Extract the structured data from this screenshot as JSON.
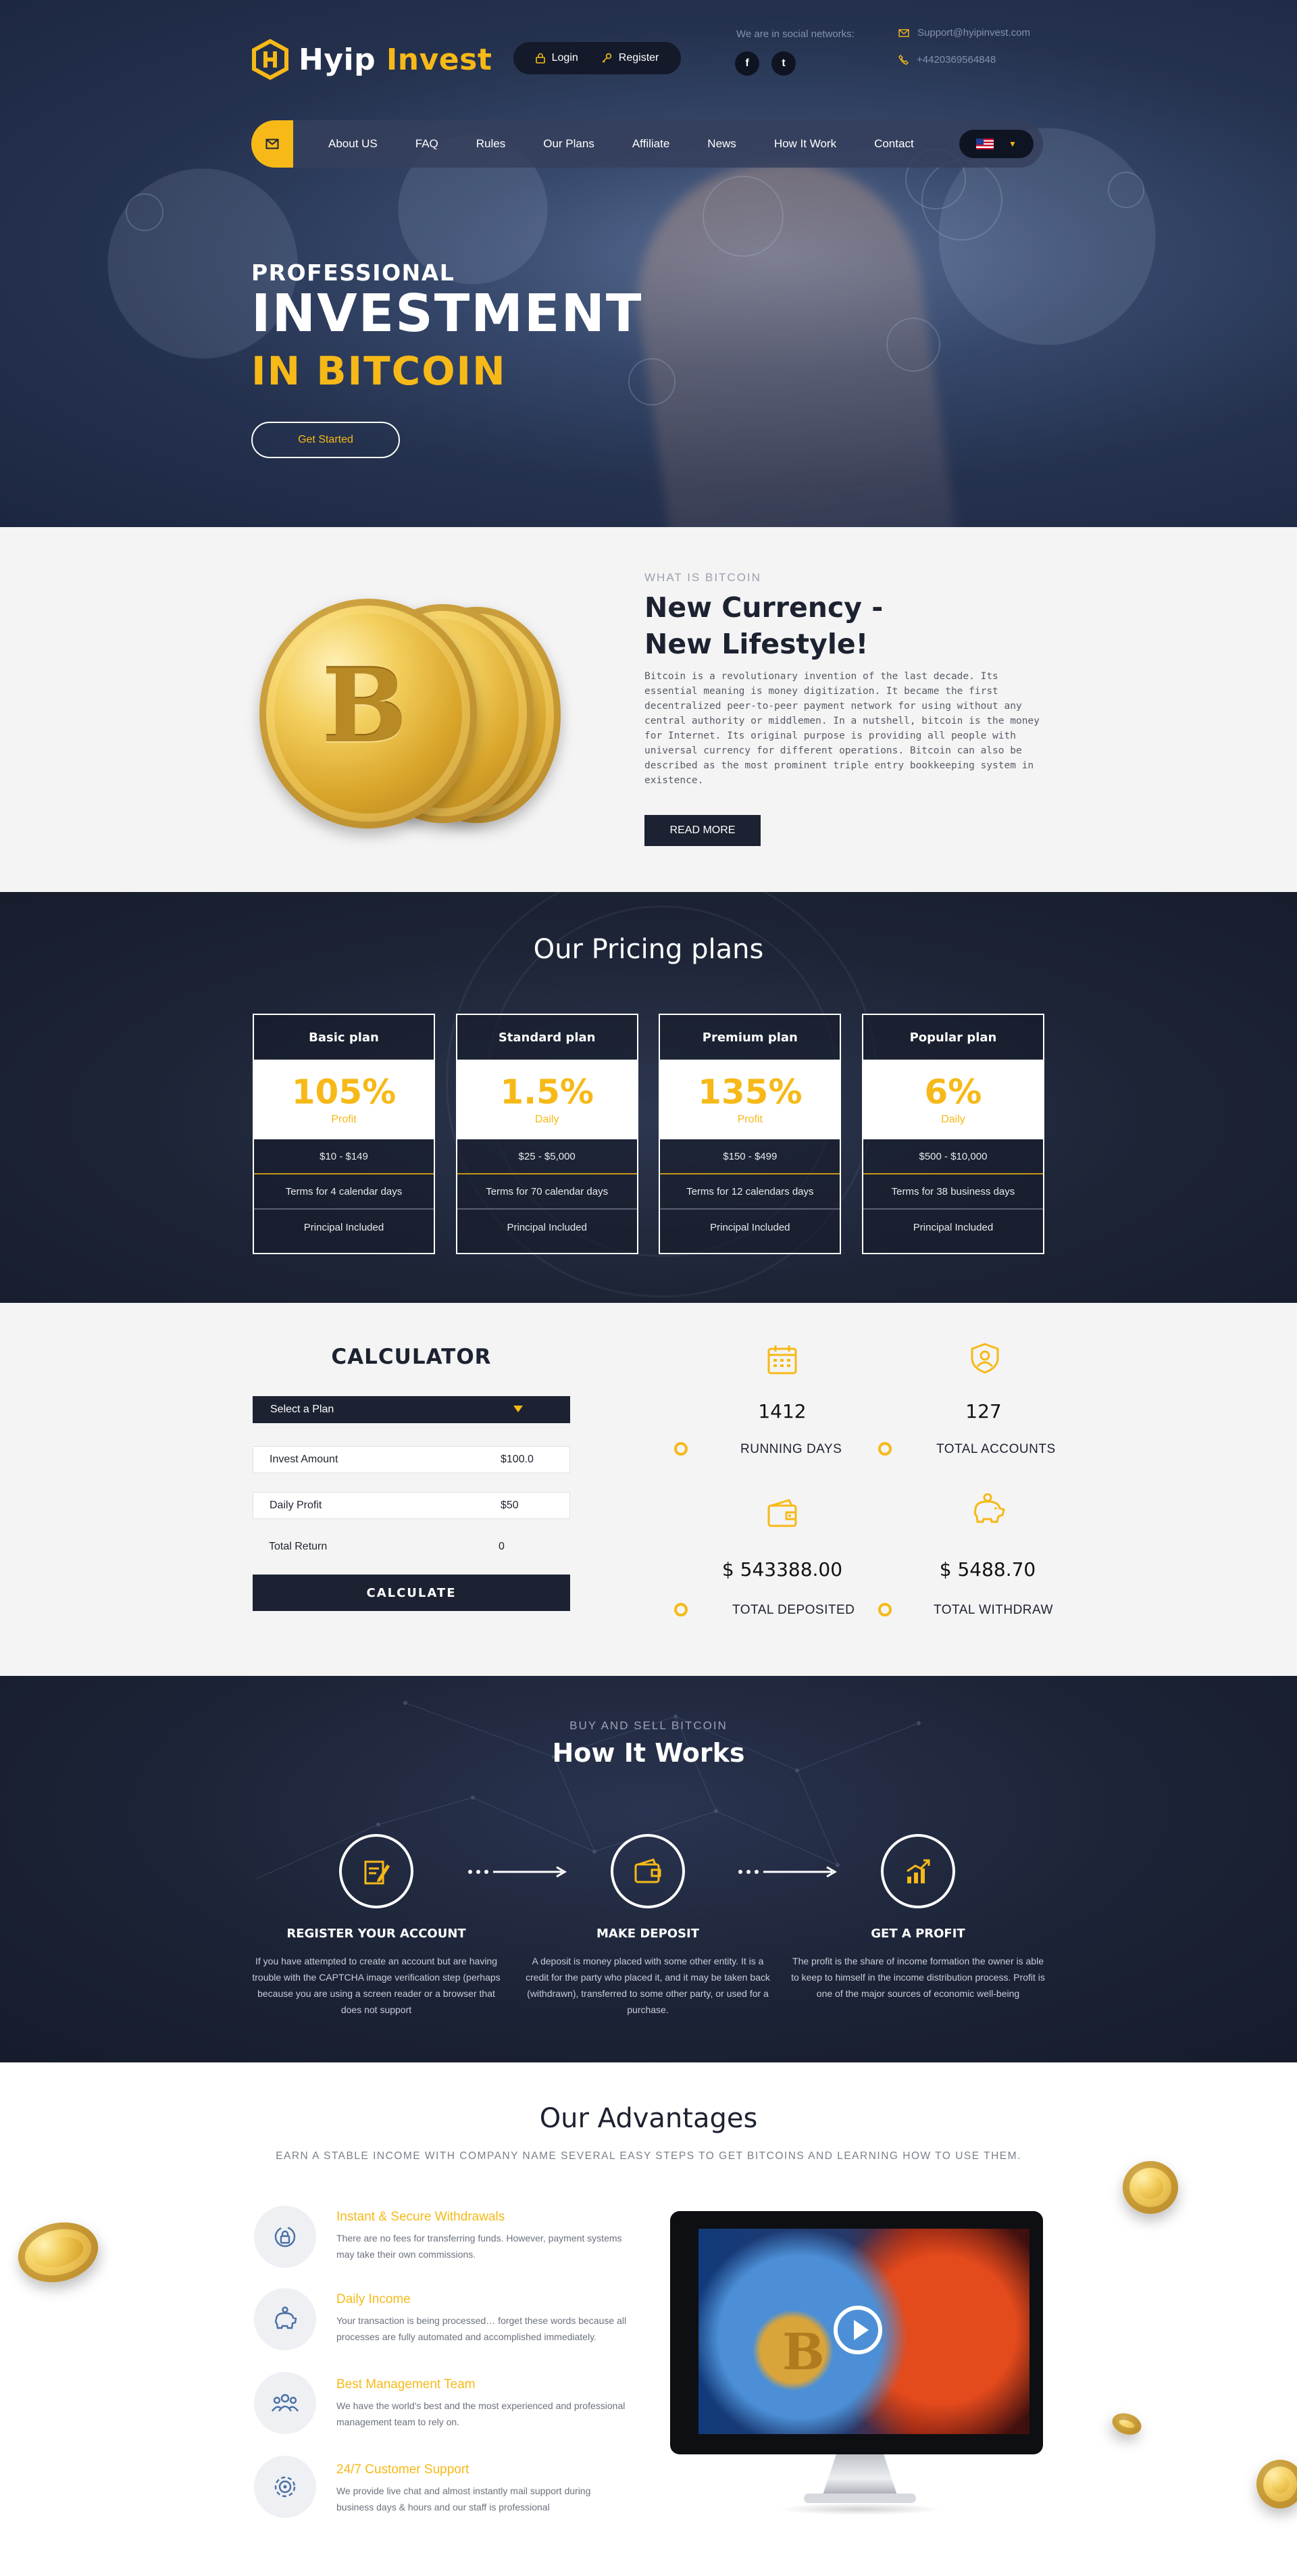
{
  "header": {
    "logo_primary": "Hyip",
    "logo_accent": "Invest",
    "login_label": "Login",
    "register_label": "Register",
    "social_label": "We are in social networks:",
    "social_facebook": "f",
    "social_twitter": "t",
    "email": "Support@hyipinvest.com",
    "phone": "+4420369564848"
  },
  "nav": {
    "items": [
      "About US",
      "FAQ",
      "Rules",
      "Our Plans",
      "Affiliate",
      "News",
      "How It Work",
      "Contact"
    ],
    "language_flag": "us-flag-icon"
  },
  "hero": {
    "line1": "PROFESSIONAL",
    "line2": "INVESTMENT",
    "line3": "IN BITCOIN",
    "button": "Get Started"
  },
  "about": {
    "eyebrow": "WHAT IS BITCOIN",
    "title_line1": "New Currency -",
    "title_line2": "New Lifestyle!",
    "body": "Bitcoin is a revolutionary invention of the last decade. Its essential meaning is money digitization. It became the first decentralized peer-to-peer payment network for using without any central authority or middlemen. In a nutshell, bitcoin is the money for Internet. Its original purpose is providing all people with universal currency for different operations. Bitcoin can also be described as the most prominent triple entry bookkeeping system in existence.",
    "button": "READ MORE"
  },
  "pricing": {
    "title": "Our Pricing plans",
    "plans": [
      {
        "name": "Basic plan",
        "rate": "105%",
        "unit": "Profit",
        "range": "$10 - $149",
        "terms": "Terms for 4 calendar days",
        "principal": "Principal Included"
      },
      {
        "name": "Standard plan",
        "rate": "1.5%",
        "unit": "Daily",
        "range": "$25 - $5,000",
        "terms": "Terms for 70 calendar days",
        "principal": "Principal Included"
      },
      {
        "name": "Premium plan",
        "rate": "135%",
        "unit": "Profit",
        "range": "$150 - $499",
        "terms": "Terms for 12 calendars days",
        "principal": "Principal Included"
      },
      {
        "name": "Popular plan",
        "rate": "6%",
        "unit": "Daily",
        "range": "$500 - $10,000",
        "terms": "Terms for 38 business days",
        "principal": "Principal Included"
      }
    ]
  },
  "calculator": {
    "title": "CALCULATOR",
    "select_placeholder": "Select a Plan",
    "invest_label": "Invest Amount",
    "invest_value": "$100.0",
    "daily_label": "Daily Profit",
    "daily_value": "$50",
    "total_label": "Total Return",
    "total_value": "0",
    "button": "CALCULATE"
  },
  "stats": [
    {
      "icon": "calendar-icon",
      "value": "1412",
      "label": "RUNNING DAYS"
    },
    {
      "icon": "user-shield-icon",
      "value": "127",
      "label": "TOTAL ACCOUNTS"
    },
    {
      "icon": "wallet-icon",
      "value": "$ 543388.00",
      "label": "TOTAL DEPOSITED"
    },
    {
      "icon": "piggy-bank-icon",
      "value": "$ 5488.70",
      "label": "TOTAL WITHDRAW"
    }
  ],
  "how": {
    "eyebrow": "BUY AND SELL BITCOIN",
    "title": "How It Works",
    "steps": [
      {
        "icon": "register-icon",
        "title": "REGISTER YOUR ACCOUNT",
        "body": "If you have attempted to create an account but are having trouble with the CAPTCHA image verification step (perhaps because you are using a screen reader or a browser that does not support"
      },
      {
        "icon": "wallet-icon",
        "title": "MAKE DEPOSIT",
        "body": "A deposit is money placed with some other entity. It is a credit for the party who placed it, and it may be taken back (withdrawn), transferred to some other party, or used for a purchase."
      },
      {
        "icon": "growth-chart-icon",
        "title": "GET A PROFIT",
        "body": "The profit is the share of income formation the owner is able to keep to himself in the income distribution process. Profit is one of the major sources of economic well-being"
      }
    ]
  },
  "advantages": {
    "title": "Our Advantages",
    "subtitle": "EARN A STABLE INCOME WITH COMPANY NAME SEVERAL EASY STEPS TO GET BITCOINS AND LEARNING HOW TO USE THEM.",
    "items": [
      {
        "icon": "secure-lock-icon",
        "title": "Instant & Secure Withdrawals",
        "text": "There are no fees for transferring funds. However, payment systems may take their own commissions."
      },
      {
        "icon": "piggy-bank-icon",
        "title": "Daily Income",
        "text": "Your transaction is being processed… forget these words because all processes are fully automated and accomplished immediately."
      },
      {
        "icon": "team-icon",
        "title": "Best Management Team",
        "text": "We have the world's best and the most experienced and professional management team to rely on."
      },
      {
        "icon": "support-gear-icon",
        "title": "24/7 Customer Support",
        "text": "We provide live chat and almost instantly mail support during business days & hours and our staff is professional"
      }
    ]
  },
  "colors": {
    "accent": "#f6b918",
    "dark": "#1c2232",
    "hero": "#25324f"
  }
}
